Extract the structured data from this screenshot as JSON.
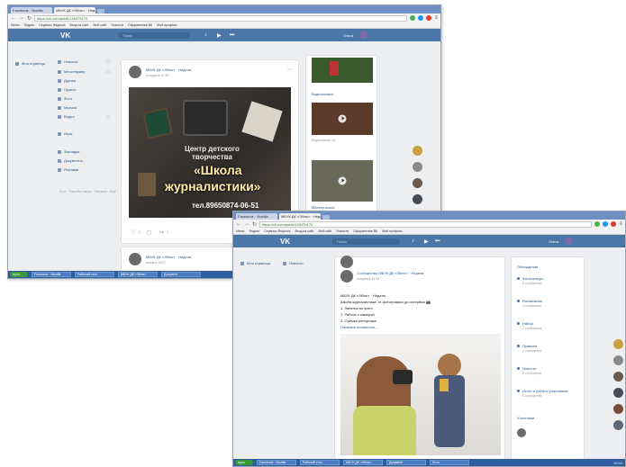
{
  "screenshot1": {
    "tabs": [
      "Facebook · Mozilla",
      "МБУК ДК «Збіль» · Неделя"
    ],
    "url": "https://vk.com/public140479170",
    "bookmarks": [
      "Меню",
      "Яндекс",
      "Сервисы Яндекса",
      "Вход на сайт",
      "Мой сайт",
      "Новости",
      "Оформление ВК",
      "Мой профиль"
    ],
    "header": {
      "logo": "VK",
      "search": "Поиск",
      "user": "Ольга"
    },
    "menu": [
      "Моя страница",
      "Новости",
      "Мессенджер",
      "Друзья",
      "Группы",
      "Фото",
      "Музыка",
      "Видео",
      "Игры",
      "Закладки",
      "Документы",
      "Реклама"
    ],
    "menu_footer": "Блог · Разработчикам · Реклама · Ещё",
    "post": {
      "author": "МБУК ДК «Збіль» · Неделя",
      "date": "сегодня в 10:35",
      "banner_lines": [
        "Центр детского",
        "творчества",
        "«Школа",
        "журналистики»"
      ],
      "phone": "тел.89650874-06-51",
      "likes": "2",
      "share": "1"
    },
    "post2": {
      "author": "МБУК ДК «Збіль» · Неделя",
      "date": "вчера в 18:07"
    },
    "sidebar": {
      "videos_title": "Видеозаписи",
      "video1": "Урок журналистики",
      "video2": "Мастер-класс",
      "video_caption": "Видеозаписи 24"
    },
    "taskbar": {
      "start": "пуск",
      "items": [
        "Facebook · Mozilla",
        "Рабочий стол",
        "МБУК ДК «Збіль»",
        "Документ"
      ],
      "clock": "10:42"
    }
  },
  "screenshot2": {
    "tabs": [
      "Facebook · Mozilla",
      "МБУК ДК «Збіль» · Неделя"
    ],
    "url": "https://vk.com/public140479170",
    "bookmarks": [
      "Меню",
      "Яндекс",
      "Сервисы Яндекса",
      "Вход на сайт",
      "Мой сайт",
      "Новости",
      "Оформление ВК",
      "Мой профиль"
    ],
    "header": {
      "logo": "VK",
      "search": "Поиск",
      "user": "Ольга"
    },
    "menu": [
      "Моя страница",
      "Новости"
    ],
    "post": {
      "author": "Сообщество МБУК ДК «Збіль» · Неделя",
      "date": "сегодня в 10:35",
      "lines": [
        "МБУК ДК «Збіль» · Неделя",
        "Школа журналистики: от фотографии до интервью 📸",
        "1. Занятия по фото",
        "2. Работа с камерой",
        "3. Съёмка репортажа"
      ],
      "more": "Показать полностью..."
    },
    "sidebar": {
      "title": "Обсуждения",
      "items": [
        {
          "name": "Фотоконкурс",
          "sub": "6 сообщений"
        },
        {
          "name": "Расписание",
          "sub": "4 сообщения"
        },
        {
          "name": "Набор",
          "sub": "3 сообщения"
        },
        {
          "name": "Правила",
          "sub": "2 сообщения"
        },
        {
          "name": "Новости",
          "sub": "5 сообщений"
        },
        {
          "name": "Итоги и работы участников",
          "sub": "8 сообщений"
        }
      ],
      "footer": "Участники"
    },
    "taskbar": {
      "start": "пуск",
      "items": [
        "Facebook · Mozilla",
        "Рабочий стол",
        "МБУК ДК «Збіль»",
        "Документ",
        "Фото"
      ],
      "clock": "10:44"
    }
  }
}
